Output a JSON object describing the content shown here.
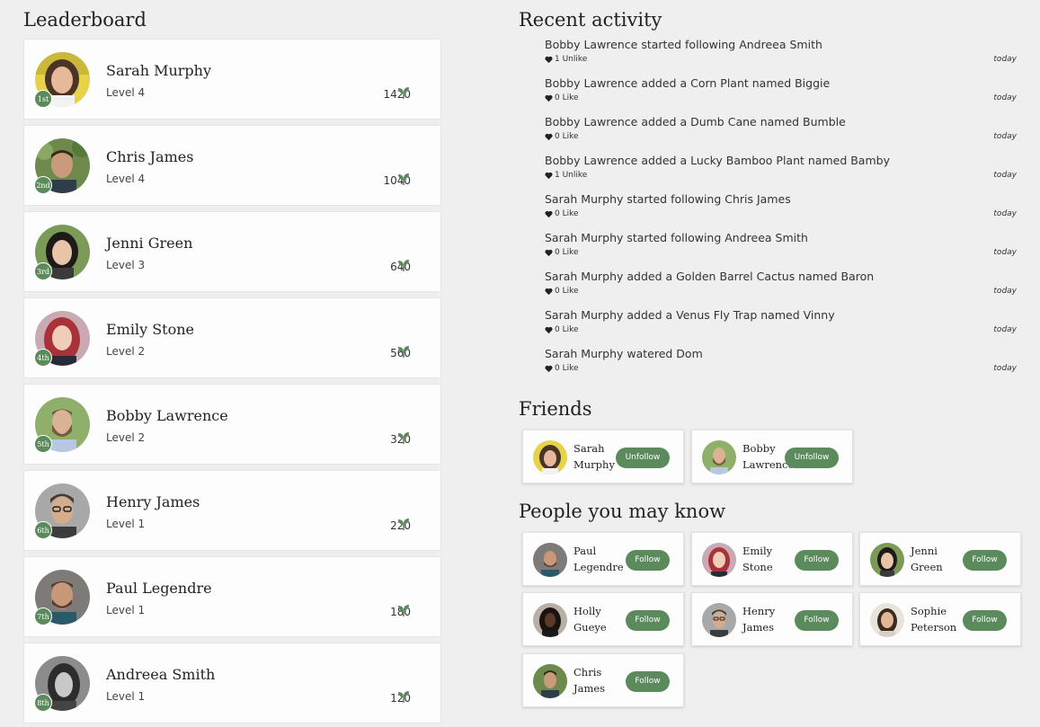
{
  "leaderboard": {
    "title": "Leaderboard",
    "entries": [
      {
        "rank": "1st",
        "name": "Sarah Murphy",
        "level": "Level 4",
        "points": "1420"
      },
      {
        "rank": "2nd",
        "name": "Chris James",
        "level": "Level 4",
        "points": "1040"
      },
      {
        "rank": "3rd",
        "name": "Jenni Green",
        "level": "Level 3",
        "points": "640"
      },
      {
        "rank": "4th",
        "name": "Emily Stone",
        "level": "Level 2",
        "points": "560"
      },
      {
        "rank": "5th",
        "name": "Bobby Lawrence",
        "level": "Level 2",
        "points": "320"
      },
      {
        "rank": "6th",
        "name": "Henry James",
        "level": "Level 1",
        "points": "220"
      },
      {
        "rank": "7th",
        "name": "Paul Legendre",
        "level": "Level 1",
        "points": "180"
      },
      {
        "rank": "8th",
        "name": "Andreea Smith",
        "level": "Level 1",
        "points": "120"
      }
    ]
  },
  "activity": {
    "title": "Recent activity",
    "items": [
      {
        "text": "Bobby Lawrence started following Andreea Smith",
        "likes": "1 Unlike",
        "time": "today"
      },
      {
        "text": "Bobby Lawrence added a Corn Plant named Biggie",
        "likes": "0 Like",
        "time": "today"
      },
      {
        "text": "Bobby Lawrence added a Dumb Cane named Bumble",
        "likes": "0 Like",
        "time": "today"
      },
      {
        "text": "Bobby Lawrence added a Lucky Bamboo Plant named Bamby",
        "likes": "1 Unlike",
        "time": "today"
      },
      {
        "text": "Sarah Murphy started following Chris James",
        "likes": "0 Like",
        "time": "today"
      },
      {
        "text": "Sarah Murphy started following Andreea Smith",
        "likes": "0 Like",
        "time": "today"
      },
      {
        "text": "Sarah Murphy added a Golden Barrel Cactus named Baron",
        "likes": "0 Like",
        "time": "today"
      },
      {
        "text": "Sarah Murphy added a Venus Fly Trap named Vinny",
        "likes": "0 Like",
        "time": "today"
      },
      {
        "text": "Sarah Murphy watered Dom",
        "likes": "0 Like",
        "time": "today"
      }
    ]
  },
  "friends": {
    "title": "Friends",
    "items": [
      {
        "first": "Sarah",
        "last": "Murphy",
        "button": "Unfollow"
      },
      {
        "first": "Bobby",
        "last": "Lawrence",
        "button": "Unfollow"
      }
    ]
  },
  "people": {
    "title": "People you may know",
    "items": [
      {
        "first": "Paul",
        "last": "Legendre",
        "button": "Follow"
      },
      {
        "first": "Emily",
        "last": "Stone",
        "button": "Follow"
      },
      {
        "first": "Jenni",
        "last": "Green",
        "button": "Follow"
      },
      {
        "first": "Holly",
        "last": "Gueye",
        "button": "Follow"
      },
      {
        "first": "Henry",
        "last": "James",
        "button": "Follow"
      },
      {
        "first": "Sophie",
        "last": "Peterson",
        "button": "Follow"
      },
      {
        "first": "Chris",
        "last": "James",
        "button": "Follow"
      }
    ]
  },
  "colors": {
    "accent": "#5b8a5c",
    "background": "#efefef",
    "card": "#fdfdfd"
  },
  "icons": {
    "points": "sprout-icon",
    "like": "heart-icon"
  }
}
